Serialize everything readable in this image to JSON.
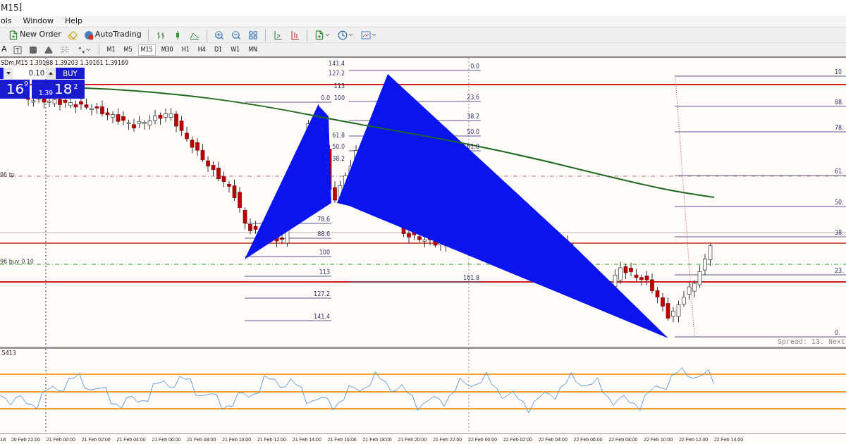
{
  "title_bar": {
    "title": "M15]"
  },
  "menu": [
    "ols",
    "Window",
    "Help"
  ],
  "toolbar": {
    "new_order": "New Order",
    "autotrading": "AutoTrading"
  },
  "text_tools": [
    "A"
  ],
  "timeframes": [
    {
      "label": "M1",
      "selected": false
    },
    {
      "label": "M5",
      "selected": false
    },
    {
      "label": "M15",
      "selected": true
    },
    {
      "label": "M30",
      "selected": false
    },
    {
      "label": "H1",
      "selected": false
    },
    {
      "label": "H4",
      "selected": false
    },
    {
      "label": "D1",
      "selected": false
    },
    {
      "label": "W1",
      "selected": false
    },
    {
      "label": "MN",
      "selected": false
    }
  ],
  "chart": {
    "info": "SDm,M15  1.39188 1.39203 1.39161 1.39169",
    "one_click": {
      "lot": "0.10",
      "buy": "BUY",
      "sell_big": "16",
      "sell_pip": "9",
      "buy_small": "1.39",
      "buy_big": "18",
      "buy_pip": "2"
    },
    "order_lines": [
      "96 tp",
      "96 buy 0.10"
    ],
    "fib_sets": [
      {
        "levels": [
          "0.0",
          "78.6",
          "88.6",
          "100",
          "113",
          "127.2",
          "141.4"
        ]
      },
      {
        "levels": [
          "141.4",
          "127.2",
          "113",
          "100",
          "61.8",
          "50.0",
          "38.2"
        ]
      },
      {
        "levels": [
          "0.0",
          "23.6",
          "38.2",
          "50.0",
          "61.8",
          "161.8"
        ]
      },
      {
        "levels": [
          "10",
          "88.",
          "78.",
          "61.",
          "50.",
          "38.",
          "23.",
          "0."
        ]
      }
    ],
    "spread": "Spread: 13. Next"
  },
  "indicator": {
    "label": ".5413"
  },
  "time_axis": [
    "18",
    "20 Feb 22:00",
    "21 Feb 00:00",
    "21 Feb 02:00",
    "21 Feb 04:00",
    "21 Feb 06:00",
    "21 Feb 08:00",
    "21 Feb 10:00",
    "21 Feb 12:00",
    "21 Feb 14:00",
    "21 Feb 16:00",
    "21 Feb 18:00",
    "21 Feb 20:00",
    "21 Feb 22:00",
    "22 Feb 00:00",
    "22 Feb 02:00",
    "22 Feb 04:00",
    "22 Feb 06:00",
    "22 Feb 08:00",
    "22 Feb 10:00",
    "22 Feb 12:00",
    "22 Feb 14:00"
  ]
}
